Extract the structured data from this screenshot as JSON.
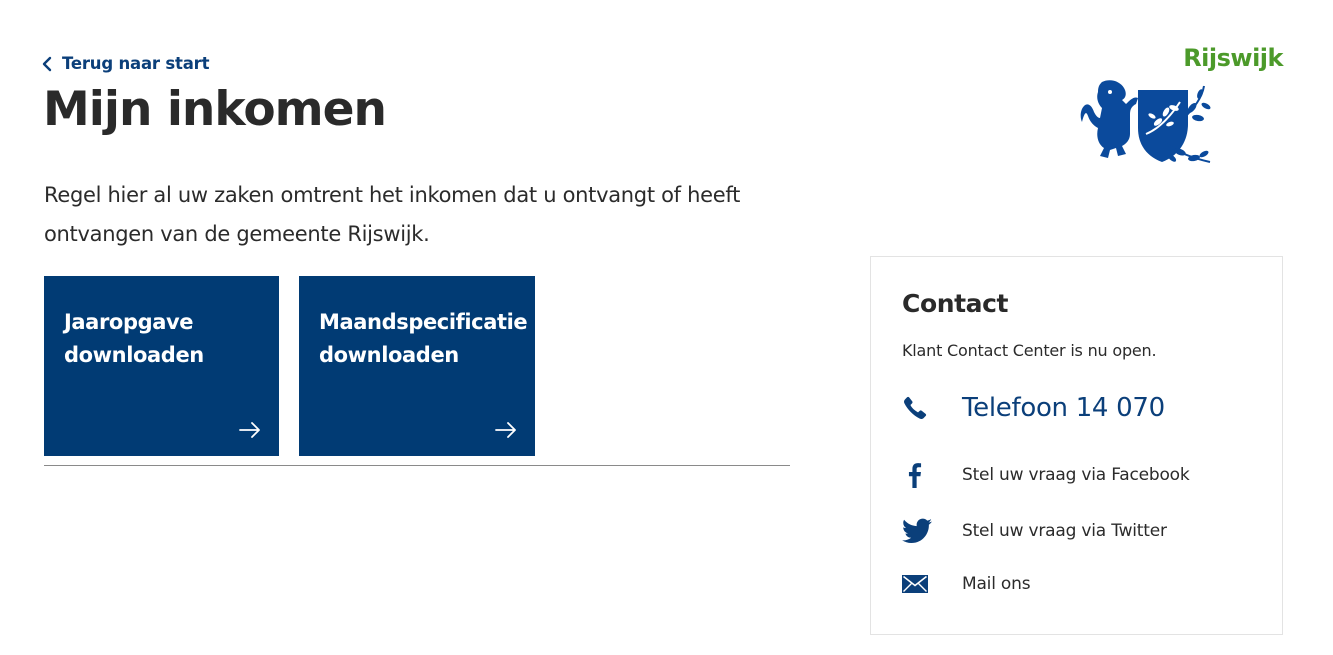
{
  "nav": {
    "back_label": "Terug naar start"
  },
  "page": {
    "title": "Mijn inkomen",
    "intro": "Regel hier al uw zaken omtrent het inkomen dat u ontvangt of heeft ontvangen van de gemeente Rijswijk."
  },
  "tiles": [
    {
      "label": "Jaaropgave downloaden",
      "icon": "arrow-right-icon"
    },
    {
      "label": "Maandspecificatie downloaden",
      "icon": "arrow-right-icon"
    }
  ],
  "brand": {
    "name": "Rijswijk",
    "logo": "rijswijk-coat-of-arms",
    "name_color": "#4c9a2a",
    "logo_color": "#0b4a9c"
  },
  "contact": {
    "title": "Contact",
    "status": "Klant Contact Center is nu open.",
    "phone": {
      "label": "Telefoon 14 070",
      "icon": "phone-icon"
    },
    "facebook": {
      "label": "Stel uw vraag via Facebook",
      "icon": "facebook-icon"
    },
    "twitter": {
      "label": "Stel uw vraag via Twitter",
      "icon": "twitter-icon"
    },
    "mail": {
      "label": "Mail ons",
      "icon": "mail-icon"
    }
  },
  "colors": {
    "primary": "#013b74",
    "link": "#0b3f7a",
    "text": "#2b2b2b"
  }
}
